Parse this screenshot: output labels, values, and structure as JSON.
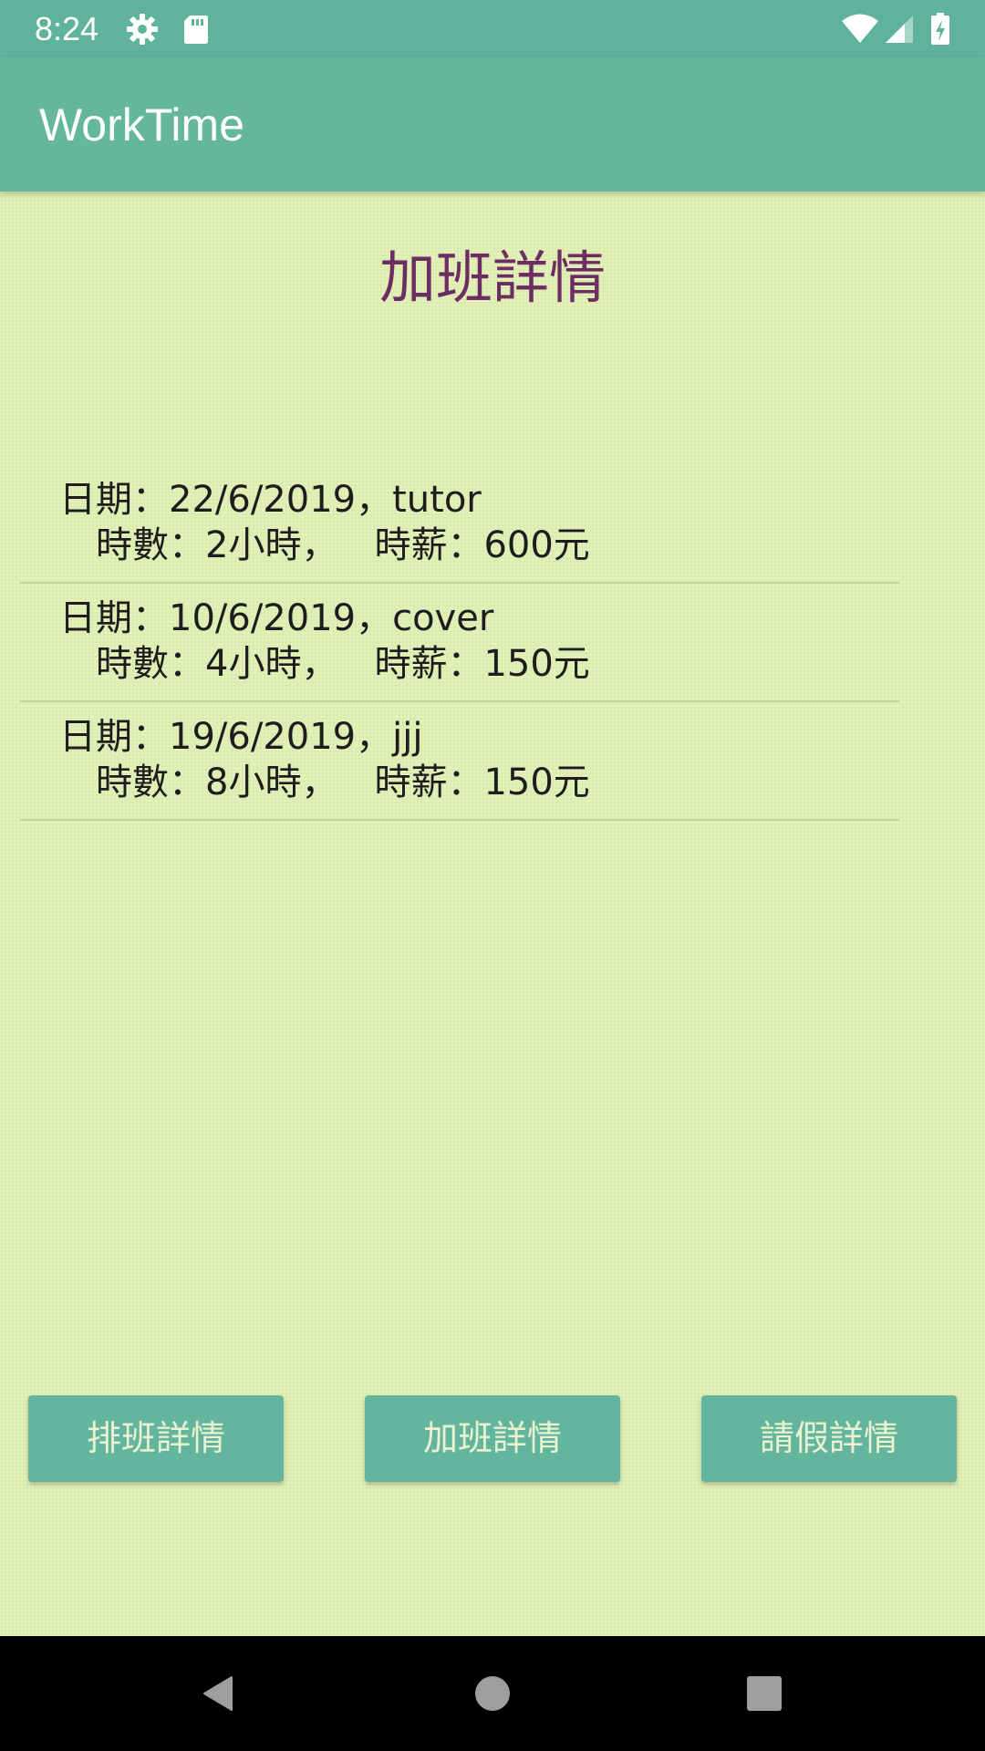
{
  "status_bar": {
    "time": "8:24",
    "icons": [
      "gear-icon",
      "sd-card-icon",
      "wifi-icon",
      "signal-icon",
      "battery-charging-icon"
    ]
  },
  "app_bar": {
    "title": "WorkTime"
  },
  "page": {
    "title": "加班詳情"
  },
  "records": [
    {
      "line1": "日期：22/6/2019，tutor",
      "hours": "時數：2小時，",
      "wage": "時薪：600元"
    },
    {
      "line1": "日期：10/6/2019，cover",
      "hours": "時數：4小時，",
      "wage": "時薪：150元"
    },
    {
      "line1": "日期：19/6/2019，jjj",
      "hours": "時數：8小時，",
      "wage": "時薪：150元"
    }
  ],
  "buttons": {
    "schedule": "排班詳情",
    "overtime": "加班詳情",
    "leave": "請假詳情"
  },
  "nav_bar": {
    "icons": [
      "back-icon",
      "home-icon",
      "recents-icon"
    ]
  },
  "colors": {
    "primary": "#64b69c",
    "status_bar": "#5fb39a",
    "background": "#e2efb6",
    "title_text": "#6b2d62",
    "button_text": "#e9f3d2"
  }
}
